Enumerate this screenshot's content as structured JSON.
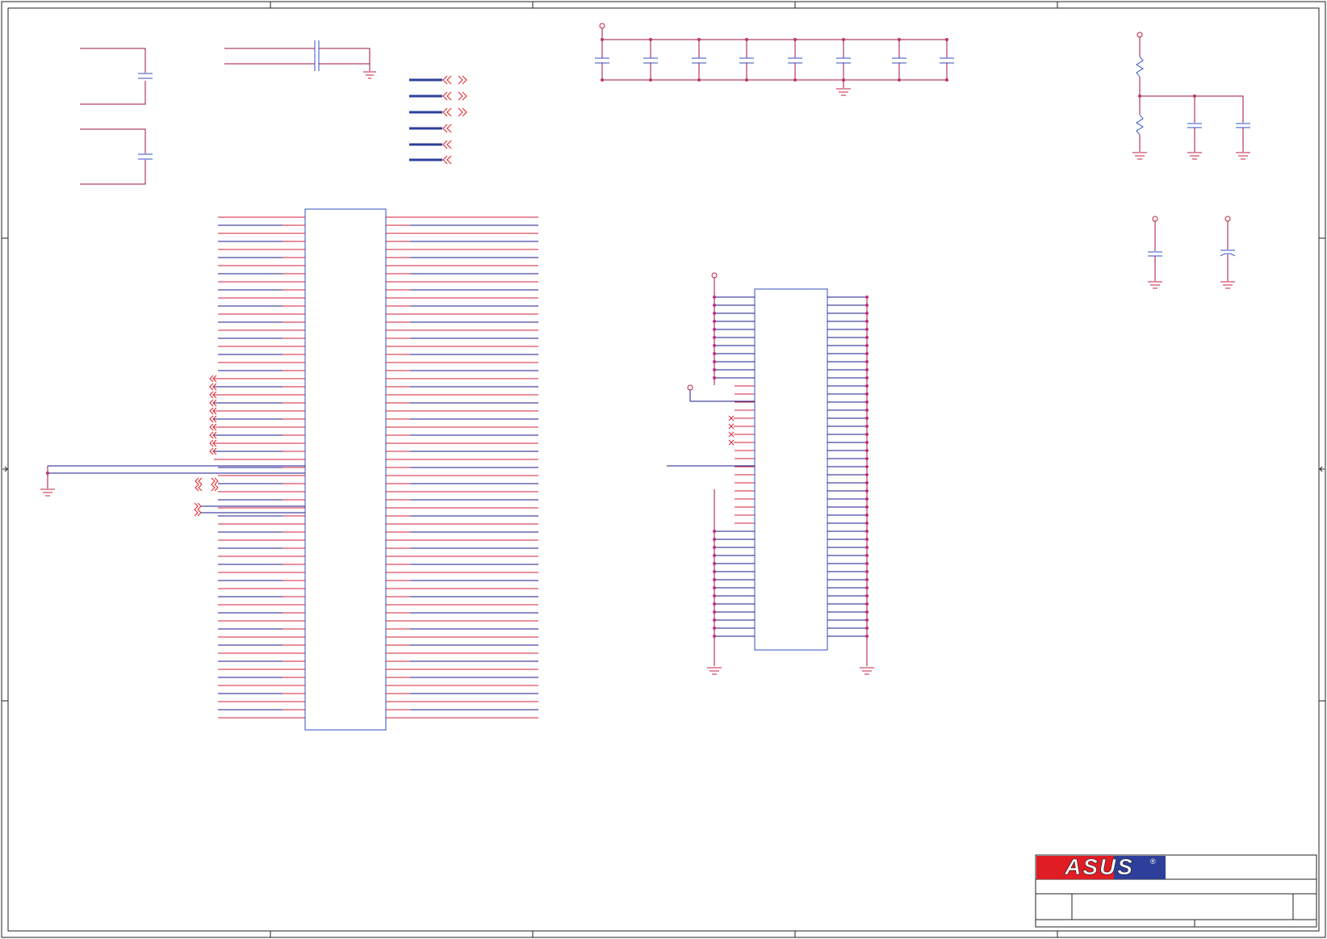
{
  "title_block": {
    "logo": "ASUS",
    "registered_mark": "®"
  },
  "colors": {
    "wire": "#d0203a",
    "net": "#1a1a8c",
    "component": "#3050c0",
    "junction": "#c0307a",
    "frame": "#222222",
    "logo_red": "#e01c24",
    "logo_blue": "#2d3f9a"
  },
  "icons": [
    "ground-icon",
    "power-rail-icon",
    "capacitor-icon",
    "resistor-icon",
    "offpage-connector-icon",
    "no-connect-icon"
  ]
}
